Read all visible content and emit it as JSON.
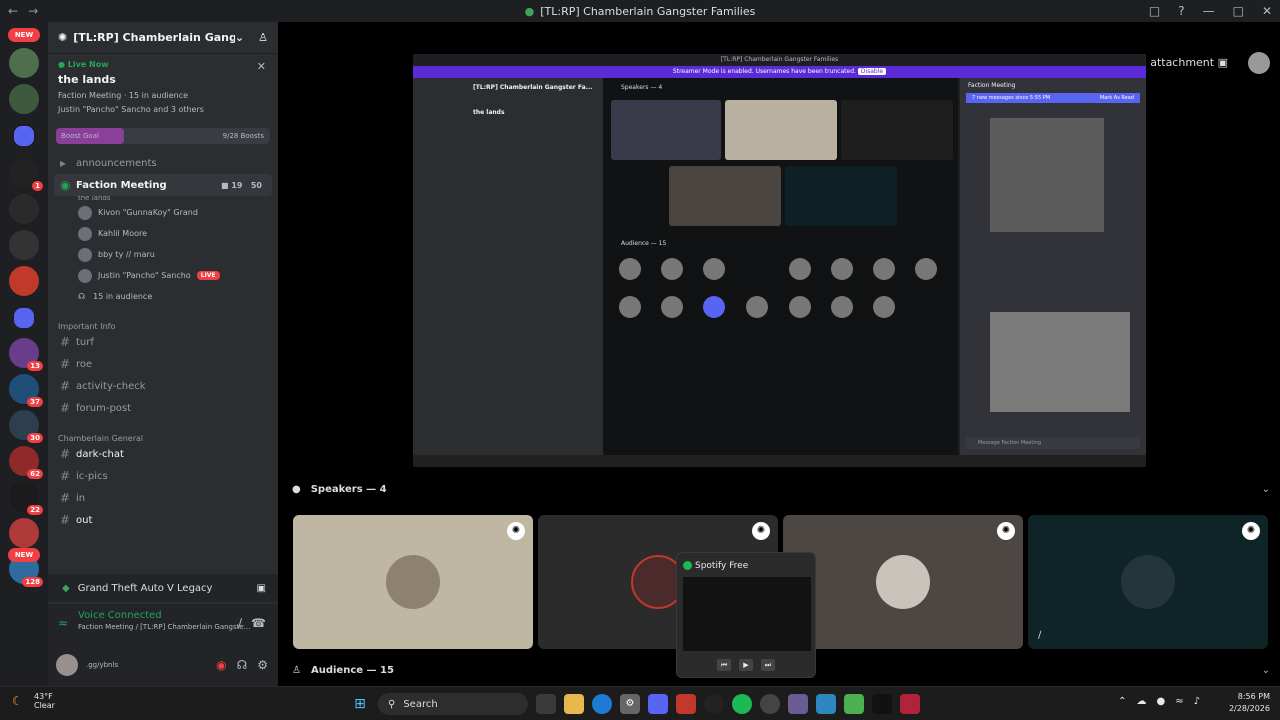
{
  "window": {
    "title": "[TL:RP] Chamberlain Gangster Families",
    "back_icon": "arrow-left",
    "forward_icon": "arrow-right"
  },
  "servers": {
    "new_top": "NEW",
    "new_bottom": "NEW",
    "badges": [
      "1",
      "13",
      "37",
      "30",
      "62",
      "22",
      "128"
    ]
  },
  "server": {
    "name": "[TL:RP] Chamberlain Gangster ...",
    "live_now": "Live Now",
    "stage_title": "the lands",
    "stage_meta": "Faction Meeting  ·  15 in audience",
    "stage_users": "Justin \"Pancho\" Sancho and 3 others",
    "boost_label": "Boost Goal",
    "boost_count": "9/28 Boosts",
    "boost_fraction": 0.32
  },
  "channels": {
    "announcements": "announcements",
    "faction_meeting": "Faction Meeting",
    "faction_meeting_sub": "the lands",
    "faction_video_count": "19",
    "faction_user_count": "50",
    "voice_users": [
      {
        "name": "Kivon \"GunnaKoy\" Grand"
      },
      {
        "name": "Kahlil Moore"
      },
      {
        "name": "bby ty // maru"
      },
      {
        "name": "Justin \"Pancho\" Sancho",
        "live": "LIVE"
      }
    ],
    "audience": "15 in audience",
    "important_info": "Important Info",
    "turf": "turf",
    "roe": "roe",
    "activity_check": "activity-check",
    "forum_post": "forum-post",
    "chamberlain_general": "Chamberlain General",
    "dark_chat": "dark-chat",
    "ic_pics": "ic-pics",
    "in": "in",
    "out": "out"
  },
  "game": {
    "name": "Grand Theft Auto V Legacy"
  },
  "voice_panel": {
    "status": "Voice Connected",
    "channel": "Faction Meeting / [TL:RP] Chamberlain Gangste..."
  },
  "user_panel": {
    "status": ".gg/ybnls"
  },
  "stage": {
    "attach_label": "Click to see attachment",
    "speakers_header": "Speakers — 4",
    "audience_header": "Audience — 15",
    "inner": {
      "title": "[TL:RP] Chamberlain Gangster Families",
      "streamer_mode": "Streamer Mode is enabled. Usernames have been truncated.",
      "disable": "Disable",
      "server_name": "[TL:RP] Chamberlain Gangster Fa...",
      "stage_title": "the lands",
      "speakers": "Speakers — 4",
      "audience": "Audience — 15",
      "chat_title": "Faction Meeting",
      "new_messages": "7 new messages since 5:55 PM",
      "mark_read": "Mark As Read",
      "message_placeholder": "Message Faction Meeting"
    }
  },
  "spotify": {
    "title": "Spotify Free"
  },
  "taskbar": {
    "temperature": "43°F",
    "condition": "Clear",
    "search": "Search",
    "time": "8:56 PM",
    "date": "2/28/2026"
  }
}
